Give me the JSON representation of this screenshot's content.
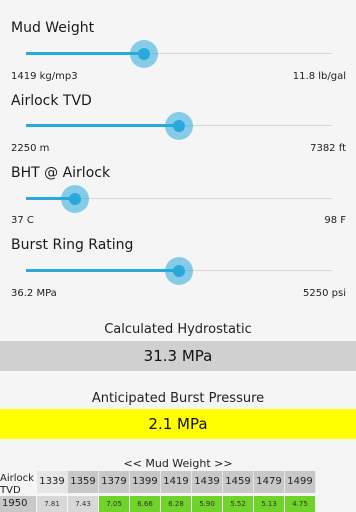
{
  "sliders": [
    {
      "title": "Mud Weight",
      "min_label": "1419 kg/mp3",
      "max_label": "11.8 lb/gal",
      "fraction": 0.385
    },
    {
      "title": "Airlock TVD",
      "min_label": "2250 m",
      "max_label": "7382 ft",
      "fraction": 0.5
    },
    {
      "title": "BHT @ Airlock",
      "min_label": "37 C",
      "max_label": "98 F",
      "fraction": 0.16
    },
    {
      "title": "Burst Ring Rating",
      "min_label": "36.2 MPa",
      "max_label": "5250 psi",
      "fraction": 0.5
    }
  ],
  "hydrostatic": {
    "title": "Calculated Hydrostatic",
    "value": "31.3 MPa"
  },
  "burst": {
    "title": "Anticipated Burst Pressure",
    "value": "2.1 MPa"
  },
  "table": {
    "header": "<< Mud Weight >>",
    "corner_line1": "Airlock",
    "corner_line2": "TVD",
    "columns": [
      "1339",
      "1359",
      "1379",
      "1399",
      "1419",
      "1439",
      "1459",
      "1479",
      "1499"
    ],
    "row_label": "1950",
    "row_values": [
      "7.81",
      "7.43",
      "7.05",
      "6.66",
      "6.28",
      "5.90",
      "5.52",
      "5.13",
      "4.75"
    ],
    "row_colors": [
      "#d8d8d8",
      "#d8d8d8",
      "#6fd32a",
      "#6fd32a",
      "#6fd32a",
      "#6fd32a",
      "#6fd32a",
      "#6fd32a",
      "#6fd32a"
    ]
  },
  "colors": {
    "accent": "#29a8dc",
    "burst_highlight": "#ffff00",
    "good": "#6fd32a"
  }
}
